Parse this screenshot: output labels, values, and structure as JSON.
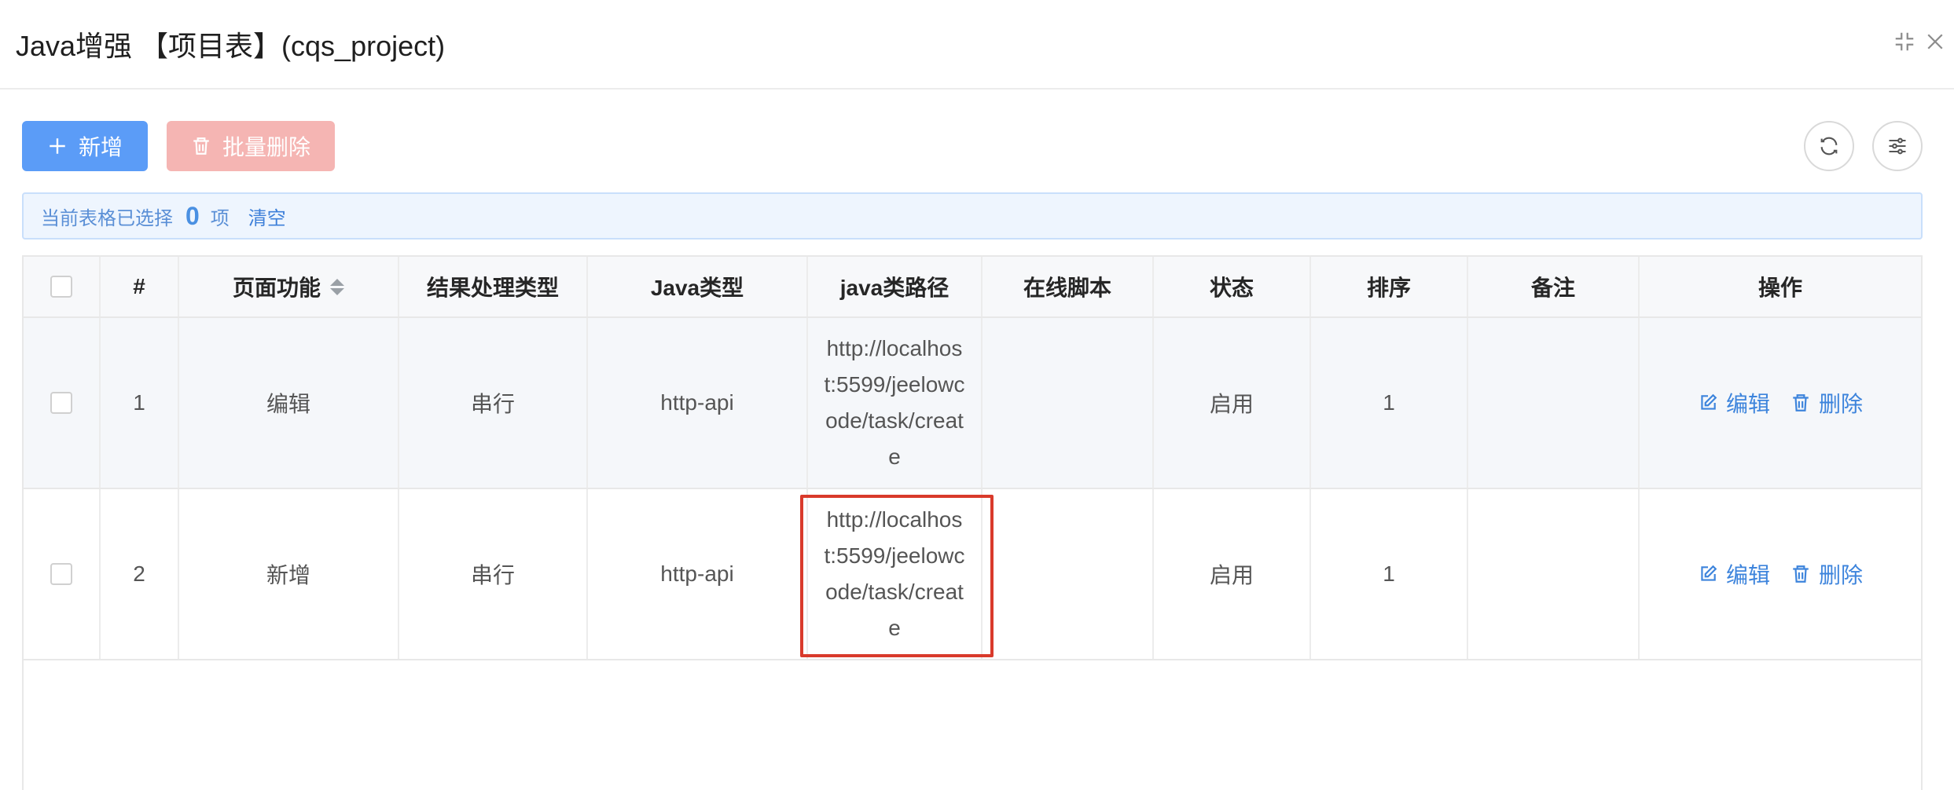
{
  "window": {
    "title": "Java增强 【项目表】(cqs_project)",
    "minimize_icon": "shrink-icon",
    "close_icon": "close-icon"
  },
  "toolbar": {
    "add_label": "新增",
    "batch_delete_label": "批量删除",
    "add_icon": "plus-icon",
    "batch_delete_icon": "trash-icon",
    "refresh_icon": "refresh-icon",
    "settings_icon": "sliders-icon"
  },
  "selection": {
    "prefix": "当前表格已选择",
    "count": "0",
    "suffix": "项",
    "clear_label": "清空"
  },
  "table": {
    "headers": [
      "#",
      "页面功能",
      "结果处理类型",
      "Java类型",
      "java类路径",
      "在线脚本",
      "状态",
      "排序",
      "备注",
      "操作"
    ],
    "rows": [
      {
        "index": "1",
        "page_function": "编辑",
        "result_type": "串行",
        "java_type": "http-api",
        "java_path": "http://localhost:5599/jeelowcode/task/create",
        "online_script": "",
        "status": "启用",
        "sort": "1",
        "remark": "",
        "edit_label": "编辑",
        "delete_label": "删除"
      },
      {
        "index": "2",
        "page_function": "新增",
        "result_type": "串行",
        "java_type": "http-api",
        "java_path": "http://localhost:5599/jeelowcode/task/create",
        "online_script": "",
        "status": "启用",
        "sort": "1",
        "remark": "",
        "edit_label": "编辑",
        "delete_label": "删除"
      }
    ]
  },
  "colors": {
    "primary": "#5b9cf7",
    "danger_disabled": "#f5b5b3",
    "link": "#3d84dc",
    "highlight_border": "#d93a2b"
  }
}
